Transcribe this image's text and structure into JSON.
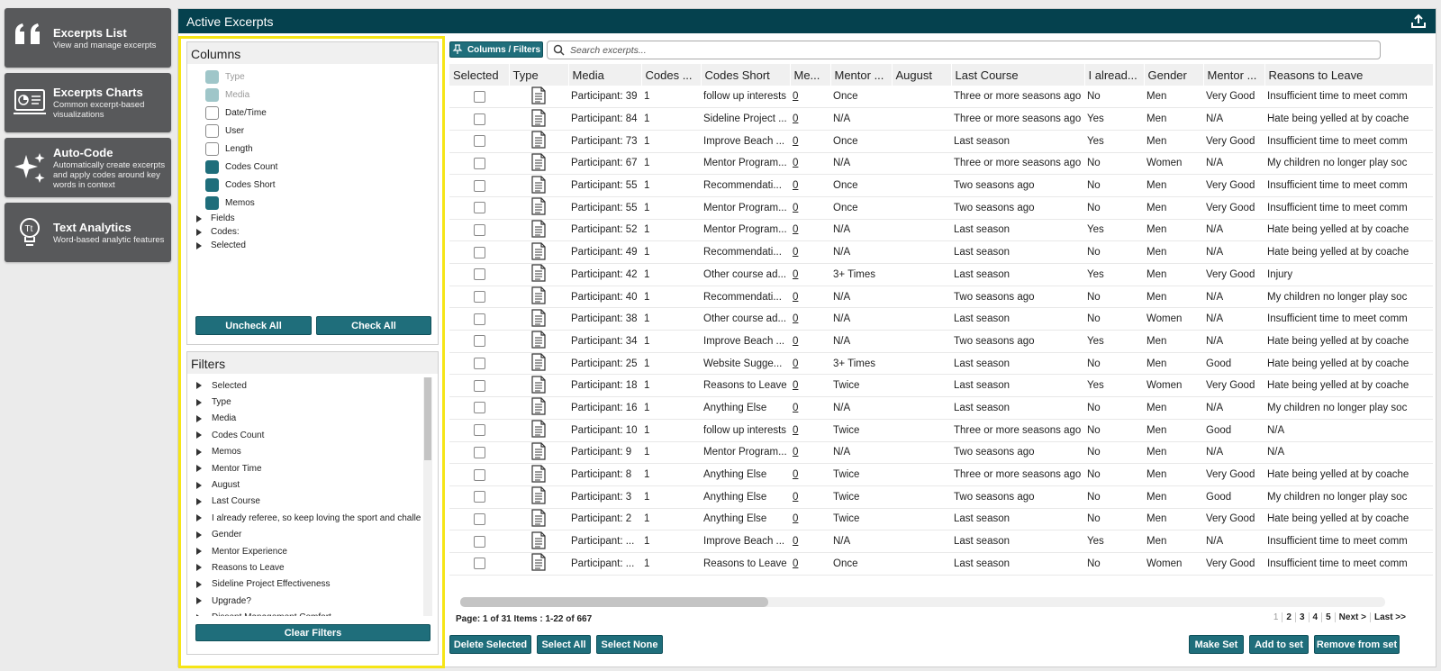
{
  "nav": [
    {
      "title": "Excerpts List",
      "subtitle": "View and manage excerpts",
      "icon": "quote-icon"
    },
    {
      "title": "Excerpts Charts",
      "subtitle": "Common excerpt-based visualizations",
      "icon": "chart-monitor-icon"
    },
    {
      "title": "Auto-Code",
      "subtitle": "Automatically create excerpts and apply codes around key words in context",
      "icon": "sparkles-icon"
    },
    {
      "title": "Text Analytics",
      "subtitle": "Word-based analytic features",
      "icon": "text-analytics-bulb-icon"
    }
  ],
  "main": {
    "title": "Active Excerpts"
  },
  "columns_panel": {
    "title": "Columns",
    "items": [
      {
        "label": "Type",
        "state": "disabled"
      },
      {
        "label": "Media",
        "state": "disabled"
      },
      {
        "label": "Date/Time",
        "state": "off"
      },
      {
        "label": "User",
        "state": "off"
      },
      {
        "label": "Length",
        "state": "off"
      },
      {
        "label": "Codes Count",
        "state": "on"
      },
      {
        "label": "Codes Short",
        "state": "on"
      },
      {
        "label": "Memos",
        "state": "on"
      }
    ],
    "groups": [
      "Fields",
      "Codes:",
      "Selected"
    ],
    "uncheck_all": "Uncheck All",
    "check_all": "Check All"
  },
  "filters_panel": {
    "title": "Filters",
    "items": [
      "Selected",
      "Type",
      "Media",
      "Codes Count",
      "Memos",
      "Mentor Time",
      "August",
      "Last Course",
      "I already referee, so keep loving the sport and challe",
      "Gender",
      "Mentor Experience",
      "Reasons to Leave",
      "Sideline Project Effectiveness",
      "Upgrade?",
      "Dissent Management Comfort"
    ],
    "clear": "Clear Filters"
  },
  "toolbar": {
    "columns_filters": "Columns / Filters",
    "search_placeholder": "Search excerpts..."
  },
  "table": {
    "headers": [
      "Selected",
      "Type",
      "Media",
      "Codes ...",
      "Codes Short",
      "Me...",
      "Mentor ...",
      "August",
      "Last Course",
      "I alread...",
      "Gender",
      "Mentor ...",
      "Reasons to Leave"
    ],
    "rows": [
      [
        "Participant: 39",
        "1",
        "follow up interests",
        "0",
        "Once",
        "",
        "Three or more seasons ago",
        "No",
        "Men",
        "Very Good",
        "Insufficient time to meet comm"
      ],
      [
        "Participant: 84",
        "1",
        "Sideline Project ...",
        "0",
        "N/A",
        "",
        "Three or more seasons ago",
        "Yes",
        "Men",
        "N/A",
        "Hate being yelled at by coache"
      ],
      [
        "Participant: 73",
        "1",
        "Improve Beach ...",
        "0",
        "Once",
        "",
        "Last season",
        "Yes",
        "Men",
        "Very Good",
        "Insufficient time to meet comm"
      ],
      [
        "Participant: 67",
        "1",
        "Mentor Program...",
        "0",
        "N/A",
        "",
        "Three or more seasons ago",
        "No",
        "Women",
        "N/A",
        "My children no longer play soc"
      ],
      [
        "Participant: 55",
        "1",
        "Recommendati...",
        "0",
        "Once",
        "",
        "Two seasons ago",
        "No",
        "Men",
        "Very Good",
        "Insufficient time to meet comm"
      ],
      [
        "Participant: 55",
        "1",
        "Mentor Program...",
        "0",
        "Once",
        "",
        "Two seasons ago",
        "No",
        "Men",
        "Very Good",
        "Insufficient time to meet comm"
      ],
      [
        "Participant: 52",
        "1",
        "Mentor Program...",
        "0",
        "N/A",
        "",
        "Last season",
        "Yes",
        "Men",
        "N/A",
        "Hate being yelled at by coache"
      ],
      [
        "Participant: 49",
        "1",
        "Recommendati...",
        "0",
        "N/A",
        "",
        "Last season",
        "No",
        "Men",
        "N/A",
        "Hate being yelled at by coache"
      ],
      [
        "Participant: 42",
        "1",
        "Other course ad...",
        "0",
        "3+ Times",
        "",
        "Last season",
        "Yes",
        "Men",
        "Very Good",
        "Injury"
      ],
      [
        "Participant: 40",
        "1",
        "Recommendati...",
        "0",
        "N/A",
        "",
        "Two seasons ago",
        "No",
        "Men",
        "N/A",
        "My children no longer play soc"
      ],
      [
        "Participant: 38",
        "1",
        "Other course ad...",
        "0",
        "N/A",
        "",
        "Last season",
        "No",
        "Women",
        "N/A",
        "Insufficient time to meet comm"
      ],
      [
        "Participant: 34",
        "1",
        "Improve Beach ...",
        "0",
        "N/A",
        "",
        "Two seasons ago",
        "Yes",
        "Men",
        "N/A",
        "Hate being yelled at by coache"
      ],
      [
        "Participant: 25",
        "1",
        "Website Sugge...",
        "0",
        "3+ Times",
        "",
        "Last season",
        "No",
        "Men",
        "Good",
        "Hate being yelled at by coache"
      ],
      [
        "Participant: 18",
        "1",
        "Reasons to Leave",
        "0",
        "Twice",
        "",
        "Last season",
        "Yes",
        "Women",
        "Very Good",
        "Hate being yelled at by coache"
      ],
      [
        "Participant: 16",
        "1",
        "Anything Else",
        "0",
        "N/A",
        "",
        "Last season",
        "No",
        "Men",
        "N/A",
        "My children no longer play soc"
      ],
      [
        "Participant: 10",
        "1",
        "follow up interests",
        "0",
        "Twice",
        "",
        "Three or more seasons ago",
        "No",
        "Men",
        "Good",
        "N/A"
      ],
      [
        "Participant: 9",
        "1",
        "Mentor Program...",
        "0",
        "N/A",
        "",
        "Two seasons ago",
        "No",
        "Men",
        "N/A",
        "N/A"
      ],
      [
        "Participant: 8",
        "1",
        "Anything Else",
        "0",
        "Twice",
        "",
        "Three or more seasons ago",
        "No",
        "Men",
        "Very Good",
        "Hate being yelled at by coache"
      ],
      [
        "Participant: 3",
        "1",
        "Anything Else",
        "0",
        "Twice",
        "",
        "Two seasons ago",
        "No",
        "Men",
        "Good",
        "My children no longer play soc"
      ],
      [
        "Participant: 2",
        "1",
        "Anything Else",
        "0",
        "Twice",
        "",
        "Last season",
        "No",
        "Men",
        "Very Good",
        "Hate being yelled at by coache"
      ],
      [
        "Participant: ...",
        "1",
        "Improve Beach ...",
        "0",
        "N/A",
        "",
        "Last season",
        "Yes",
        "Men",
        "N/A",
        "Insufficient time to meet comm"
      ],
      [
        "Participant: ...",
        "1",
        "Reasons to Leave",
        "0",
        "Once",
        "",
        "Last season",
        "No",
        "Women",
        "Very Good",
        "Insufficient time to meet comm"
      ]
    ]
  },
  "pagination": {
    "info": "Page: 1 of 31 Items : 1-22 of 667",
    "pages": [
      "1",
      "2",
      "3",
      "4",
      "5"
    ],
    "next": "Next >",
    "last": "Last >>"
  },
  "actions": {
    "delete_selected": "Delete Selected",
    "select_all": "Select All",
    "select_none": "Select None",
    "make_set": "Make Set",
    "add_to_set": "Add to set",
    "remove_from_set": "Remove from set"
  },
  "colors": {
    "accent": "#1f6e7b",
    "header": "#05414e",
    "nav": "#58595b",
    "highlight": "#f6e516"
  }
}
